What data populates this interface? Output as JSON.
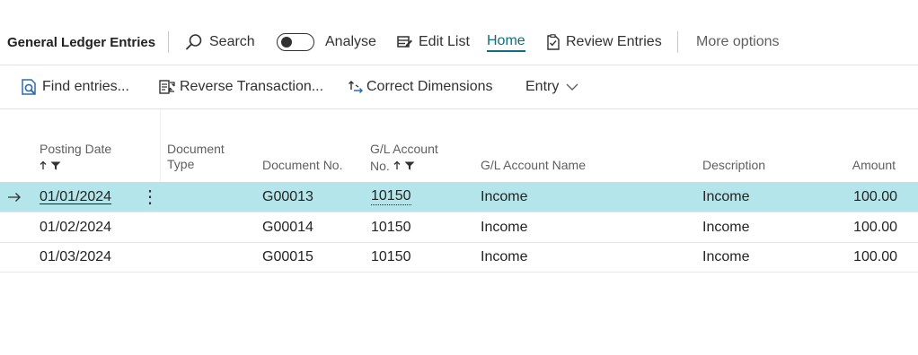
{
  "page": {
    "title": "General Ledger Entries",
    "actions": {
      "search": "Search",
      "analyse": "Analyse",
      "edit_list": "Edit List",
      "home": "Home",
      "review_entries": "Review Entries",
      "more_options": "More options"
    }
  },
  "toolbar": {
    "find_entries": "Find entries...",
    "reverse_transaction": "Reverse Transaction...",
    "correct_dimensions": "Correct Dimensions",
    "entry_menu": "Entry"
  },
  "table": {
    "columns": {
      "posting_date": "Posting Date",
      "document_type_line1": "Document",
      "document_type_line2": "Type",
      "document_no": "Document No.",
      "gl_account_no_line1": "G/L Account",
      "gl_account_no_line2": "No.",
      "gl_account_name": "G/L Account Name",
      "description": "Description",
      "amount": "Amount"
    },
    "rows": [
      {
        "posting_date": "01/01/2024",
        "document_type": "",
        "document_no": "G00013",
        "gl_account_no": "10150",
        "gl_account_name": "Income",
        "description": "Income",
        "amount": "100.00",
        "selected": true
      },
      {
        "posting_date": "01/02/2024",
        "document_type": "",
        "document_no": "G00014",
        "gl_account_no": "10150",
        "gl_account_name": "Income",
        "description": "Income",
        "amount": "100.00",
        "selected": false
      },
      {
        "posting_date": "01/03/2024",
        "document_type": "",
        "document_no": "G00015",
        "gl_account_no": "10150",
        "gl_account_name": "Income",
        "description": "Income",
        "amount": "100.00",
        "selected": false
      }
    ]
  },
  "icons": {
    "search": "search-icon",
    "edit_list": "edit-list-icon",
    "review_entries": "review-entries-icon",
    "find_entries": "find-entries-icon",
    "reverse_transaction": "reverse-transaction-icon",
    "correct_dimensions": "correct-dimensions-icon",
    "sort_asc": "sort-ascending-icon",
    "filter": "filter-icon",
    "row_pointer": "row-pointer-arrow-icon",
    "row_menu": "row-menu-icon"
  },
  "colors": {
    "accent": "#0f6f7f",
    "selected_row": "#b3e5ea",
    "text": "#242424",
    "muted": "#5f5f5f"
  }
}
